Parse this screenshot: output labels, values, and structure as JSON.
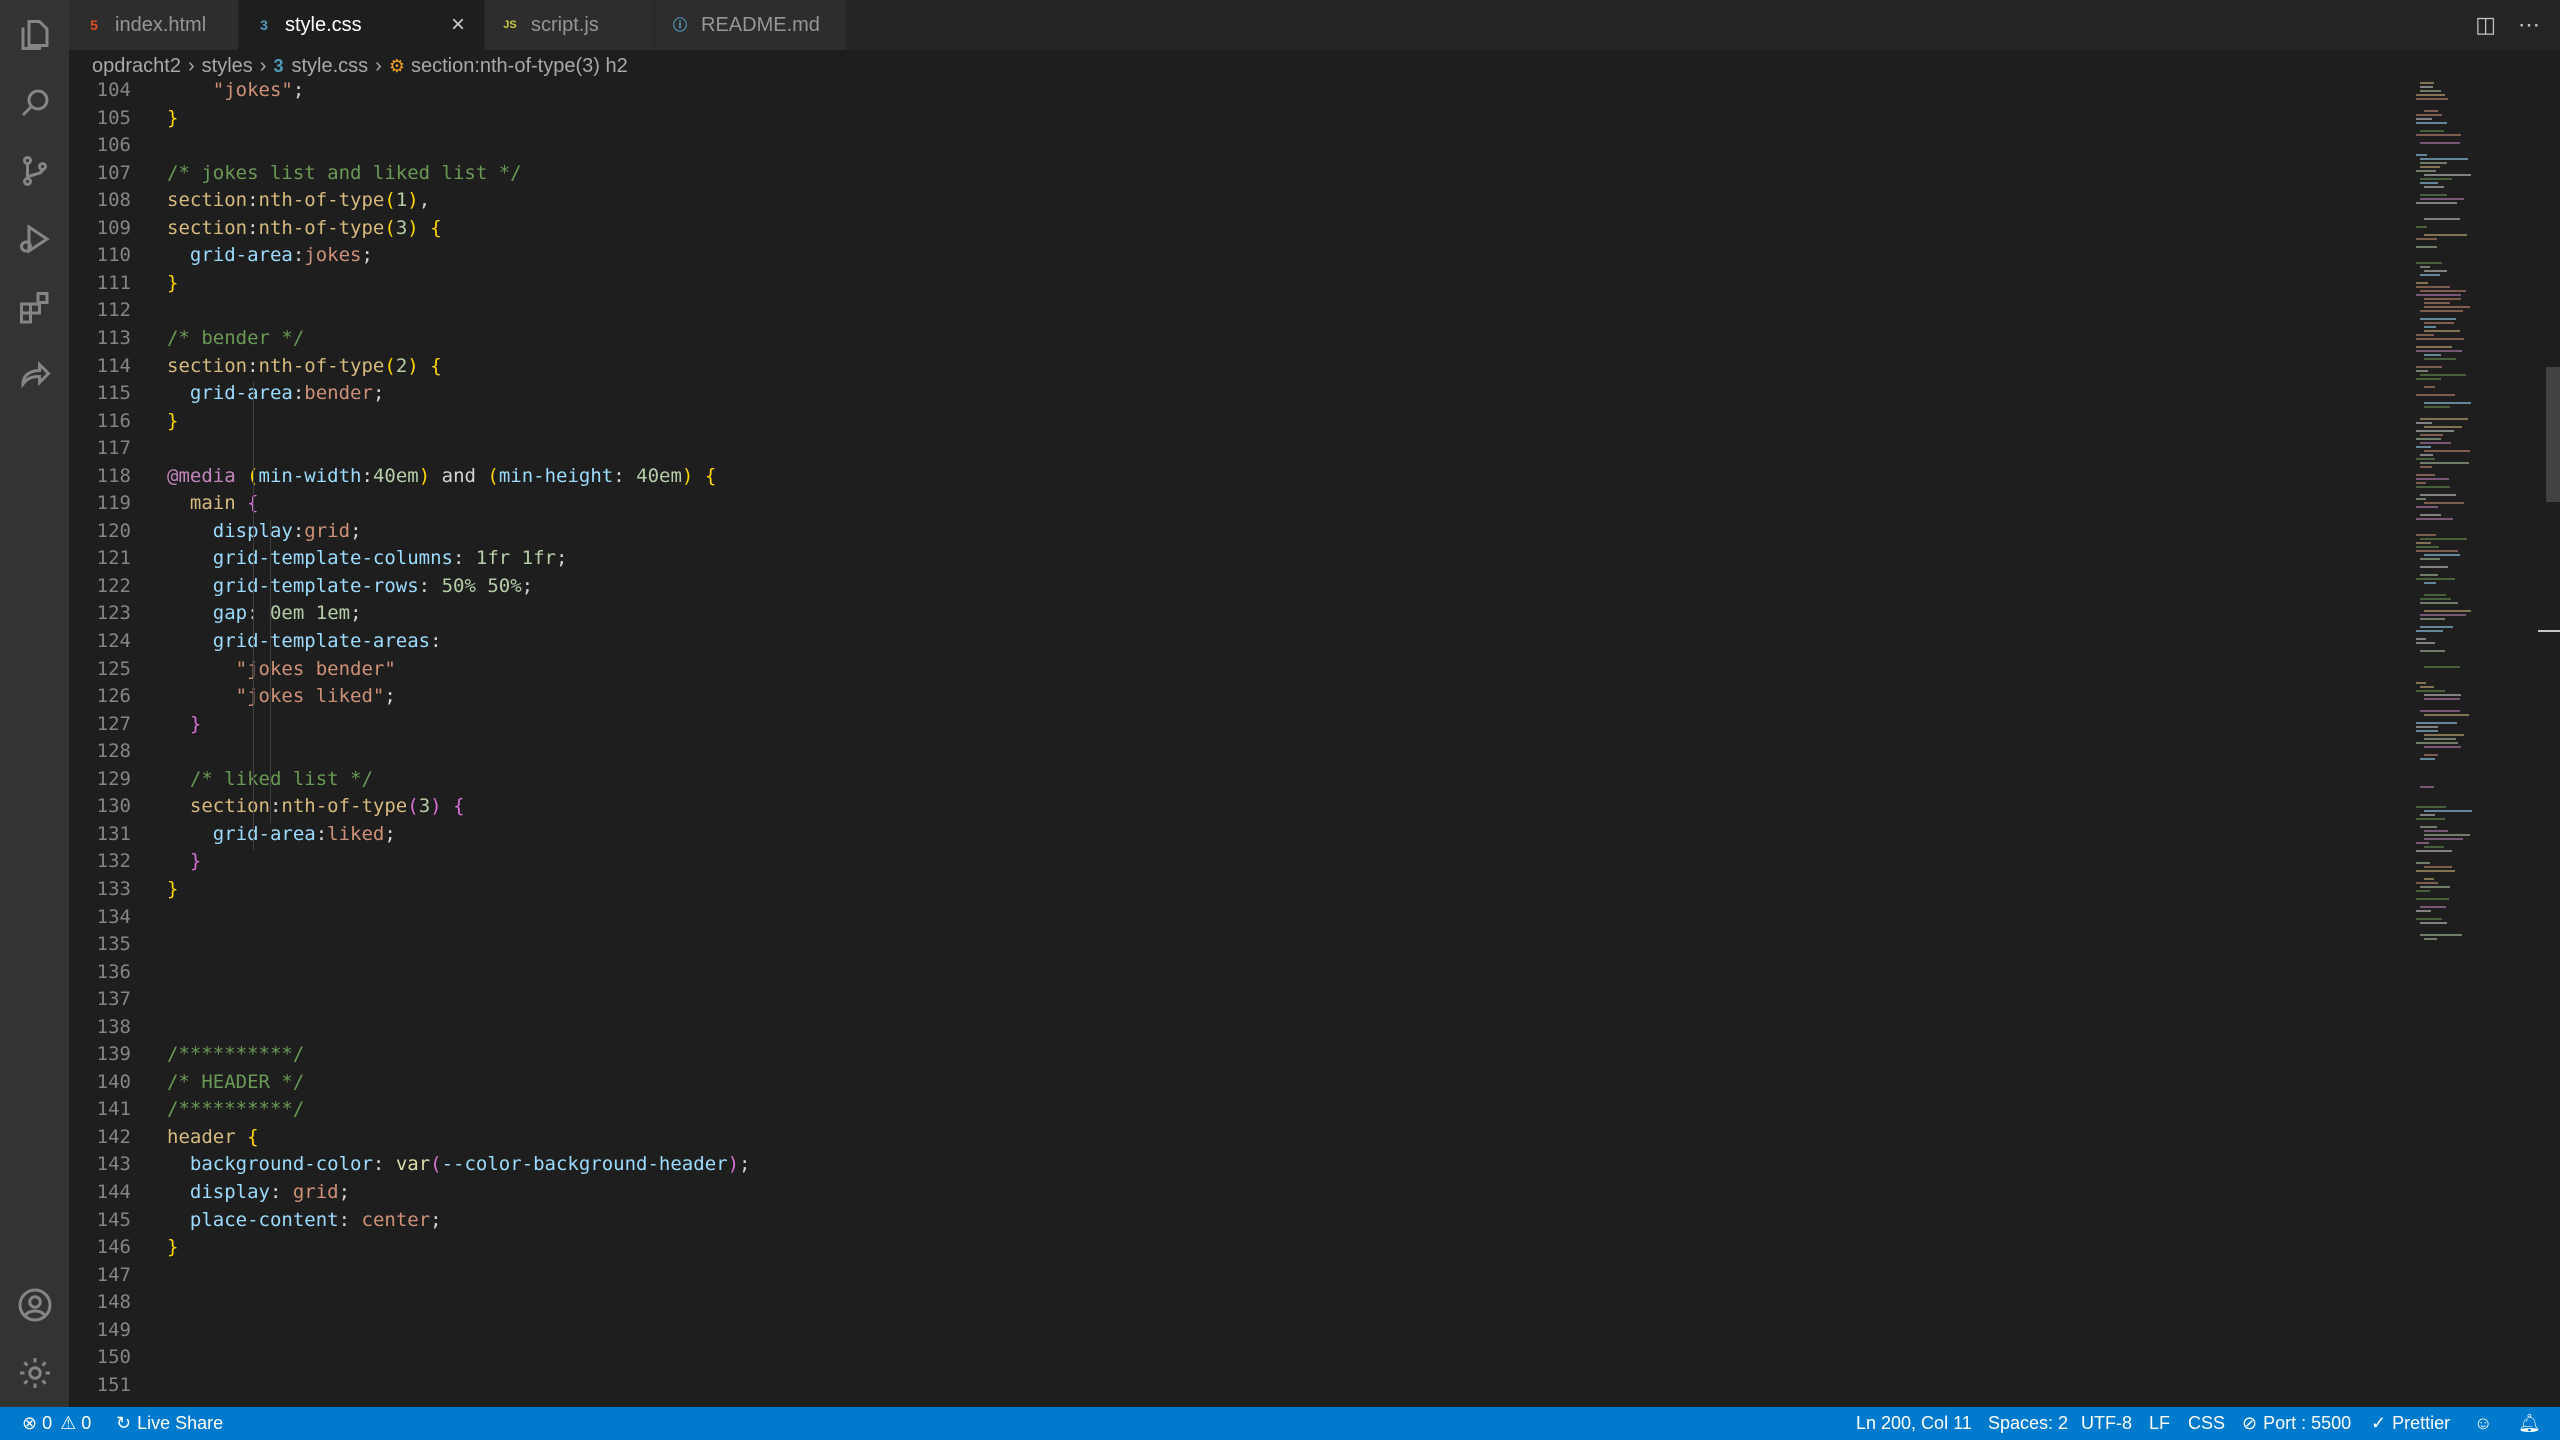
{
  "tabs": [
    {
      "label": "index.html",
      "icon": "html5-icon",
      "color": "#e44d26"
    },
    {
      "label": "style.css",
      "icon": "css3-icon",
      "color": "#519aba",
      "active": true
    },
    {
      "label": "script.js",
      "icon": "javascript-icon",
      "color": "#cbcb41"
    },
    {
      "label": "README.md",
      "icon": "info-icon",
      "color": "#519aba"
    }
  ],
  "breadcrumb": {
    "folder": "opdracht2",
    "subfolder": "styles",
    "file": "style.css",
    "symbol": "section:nth-of-type(3) h2"
  },
  "editor": {
    "lines": [
      {
        "n": "104",
        "t": "    \"jokes\";"
      },
      {
        "n": "105",
        "t": "}"
      },
      {
        "n": "106",
        "t": ""
      },
      {
        "n": "107",
        "t": "/* jokes list and liked list */"
      },
      {
        "n": "108",
        "t": "section:nth-of-type(1),"
      },
      {
        "n": "109",
        "t": "section:nth-of-type(3) {"
      },
      {
        "n": "110",
        "t": "  grid-area:jokes;"
      },
      {
        "n": "111",
        "t": "}"
      },
      {
        "n": "112",
        "t": ""
      },
      {
        "n": "113",
        "t": "/* bender */"
      },
      {
        "n": "114",
        "t": "section:nth-of-type(2) {"
      },
      {
        "n": "115",
        "t": "  grid-area:bender;"
      },
      {
        "n": "116",
        "t": "}"
      },
      {
        "n": "117",
        "t": ""
      },
      {
        "n": "118",
        "t": "@media (min-width:40em) and (min-height: 40em) {"
      },
      {
        "n": "119",
        "t": "  main {"
      },
      {
        "n": "120",
        "t": "    display:grid;"
      },
      {
        "n": "121",
        "t": "    grid-template-columns: 1fr 1fr;"
      },
      {
        "n": "122",
        "t": "    grid-template-rows: 50% 50%;"
      },
      {
        "n": "123",
        "t": "    gap: 0em 1em;"
      },
      {
        "n": "124",
        "t": "    grid-template-areas:"
      },
      {
        "n": "125",
        "t": "      \"jokes bender\""
      },
      {
        "n": "126",
        "t": "      \"jokes liked\";"
      },
      {
        "n": "127",
        "t": "  }"
      },
      {
        "n": "128",
        "t": ""
      },
      {
        "n": "129",
        "t": "  /* liked list */"
      },
      {
        "n": "130",
        "t": "  section:nth-of-type(3) {"
      },
      {
        "n": "131",
        "t": "    grid-area:liked;"
      },
      {
        "n": "132",
        "t": "  }"
      },
      {
        "n": "133",
        "t": "}"
      },
      {
        "n": "134",
        "t": ""
      },
      {
        "n": "135",
        "t": ""
      },
      {
        "n": "136",
        "t": ""
      },
      {
        "n": "137",
        "t": ""
      },
      {
        "n": "138",
        "t": ""
      },
      {
        "n": "139",
        "t": "/**********/"
      },
      {
        "n": "140",
        "t": "/* HEADER */"
      },
      {
        "n": "141",
        "t": "/**********/"
      },
      {
        "n": "142",
        "t": "header {"
      },
      {
        "n": "143",
        "t": "  background-color: var(--color-background-header);"
      },
      {
        "n": "144",
        "t": "  display: grid;"
      },
      {
        "n": "145",
        "t": "  place-content: center;"
      },
      {
        "n": "146",
        "t": "}"
      },
      {
        "n": "147",
        "t": ""
      },
      {
        "n": "148",
        "t": ""
      },
      {
        "n": "149",
        "t": ""
      },
      {
        "n": "150",
        "t": ""
      },
      {
        "n": "151",
        "t": ""
      }
    ]
  },
  "status": {
    "errors": "0",
    "warnings": "0",
    "live_share": "Live Share",
    "cursor": "Ln 200, Col 11",
    "spaces": "Spaces: 2",
    "encoding": "UTF-8",
    "eol": "LF",
    "language": "CSS",
    "port": "Port : 5500",
    "prettier": "Prettier"
  }
}
